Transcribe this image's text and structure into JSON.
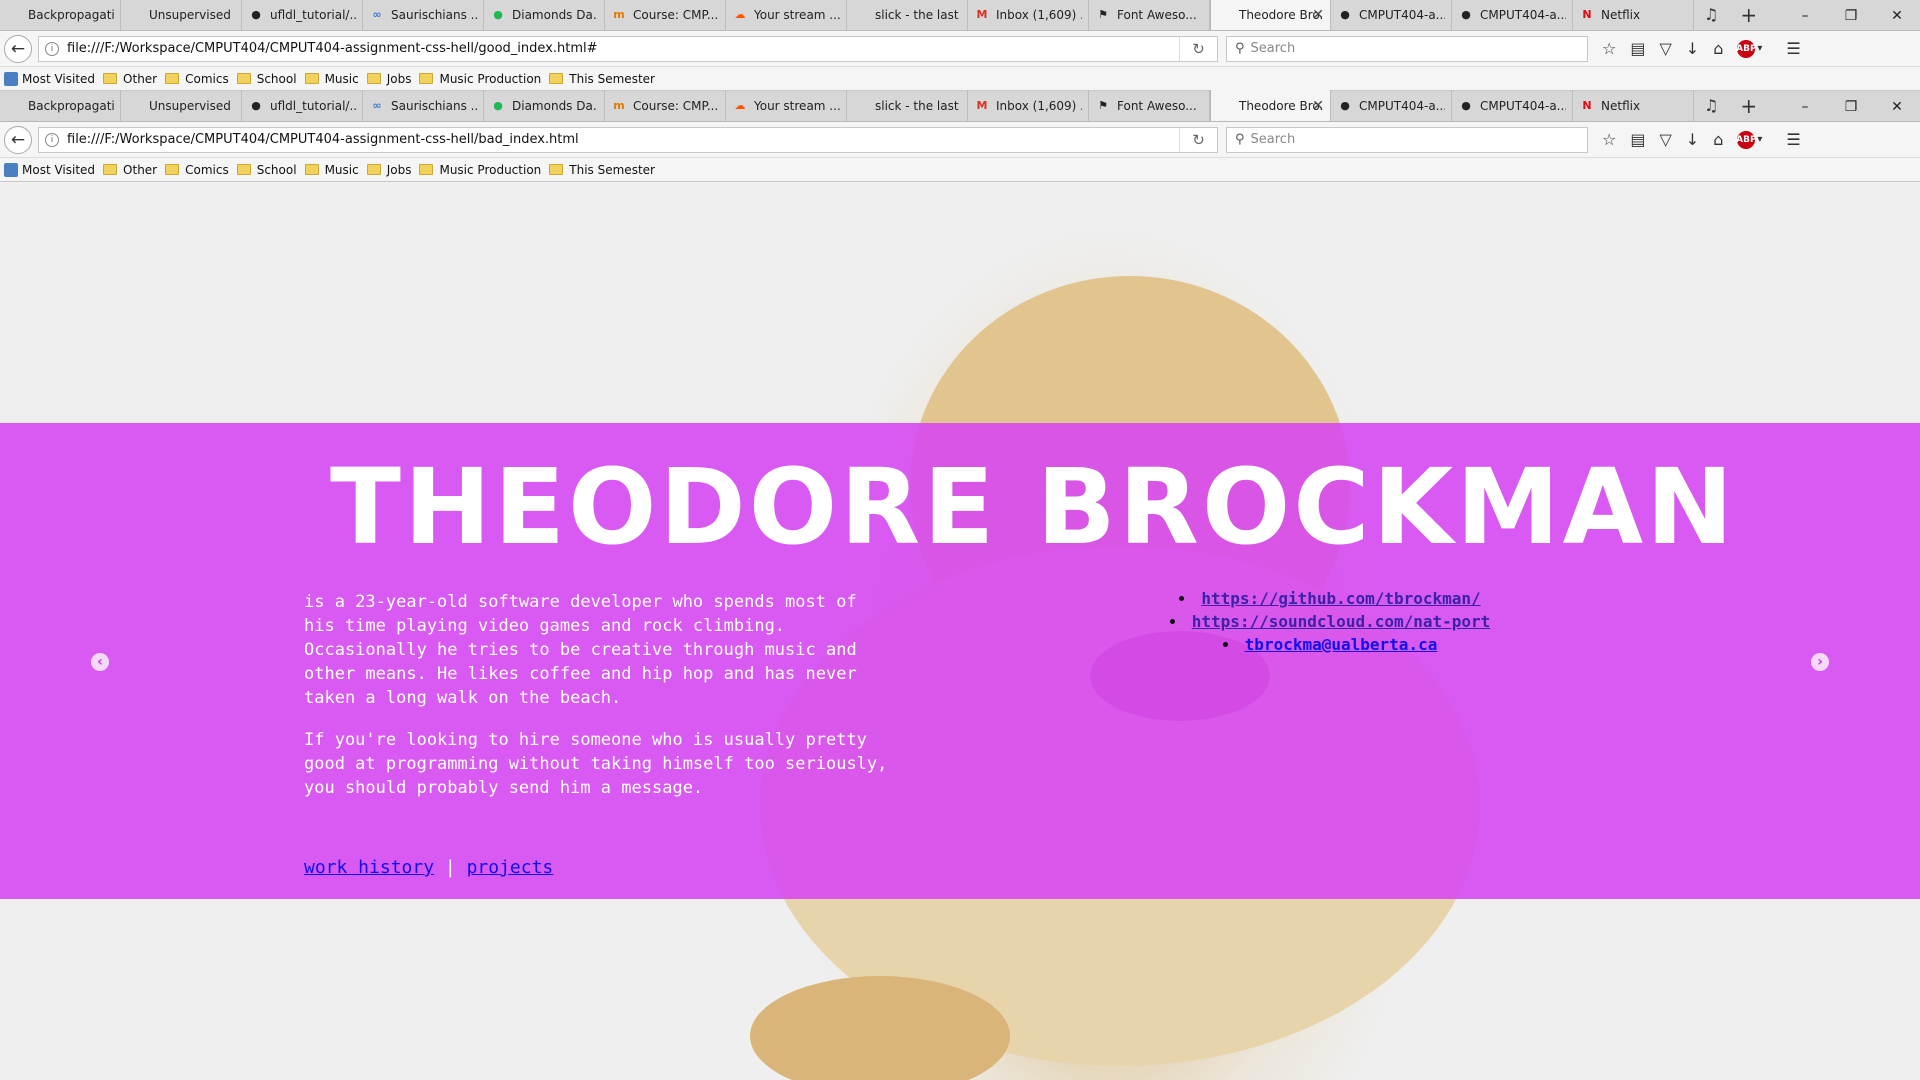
{
  "browser": {
    "tabs": [
      {
        "label": "Backpropagation ...",
        "icon": "blank"
      },
      {
        "label": "Unsupervised Fea...",
        "icon": "blank"
      },
      {
        "label": "ufldl_tutorial/...",
        "icon": "github"
      },
      {
        "label": "Saurischians ...",
        "icon": "link"
      },
      {
        "label": "Diamonds Da...",
        "icon": "spotify"
      },
      {
        "label": "Course: CMP...",
        "icon": "moodle"
      },
      {
        "label": "Your stream ...",
        "icon": "soundcloud"
      },
      {
        "label": "slick - the last car...",
        "icon": "blank"
      },
      {
        "label": "Inbox (1,609) ...",
        "icon": "gmail"
      },
      {
        "label": "Font Aweso...",
        "icon": "flag"
      },
      {
        "label": "Theodore Bro...",
        "icon": "blank",
        "active": true
      },
      {
        "label": "CMPUT404-a...",
        "icon": "github"
      },
      {
        "label": "CMPUT404-a...",
        "icon": "github"
      },
      {
        "label": "Netflix",
        "icon": "netflix"
      }
    ],
    "window1": {
      "url": "file:///F:/Workspace/CMPUT404/CMPUT404-assignment-css-hell/good_index.html#"
    },
    "window2": {
      "url": "file:///F:/Workspace/CMPUT404/CMPUT404-assignment-css-hell/bad_index.html"
    },
    "search_placeholder": "Search",
    "bookmarks": [
      "Most Visited",
      "Other",
      "Comics",
      "School",
      "Music",
      "Jobs",
      "Music Production",
      "This Semester"
    ]
  },
  "page": {
    "title": "THEODORE BROCKMAN",
    "bio_p1": "is a 23-year-old software developer who spends most of his time playing video games and rock climbing. Occasionally he tries to be creative through music and other means. He likes coffee and hip hop and has never taken a long walk on the beach.",
    "bio_p2": "If you're looking to hire someone who is usually pretty good at programming without taking himself too seriously, you should probably send him a message.",
    "links": [
      "https://github.com/tbrockman/",
      "https://soundcloud.com/nat-port",
      "tbrockma@ualberta.ca"
    ],
    "nav": {
      "work_history": "work history",
      "separator": "|",
      "projects": "projects"
    },
    "banner_color": "#d646f3"
  }
}
